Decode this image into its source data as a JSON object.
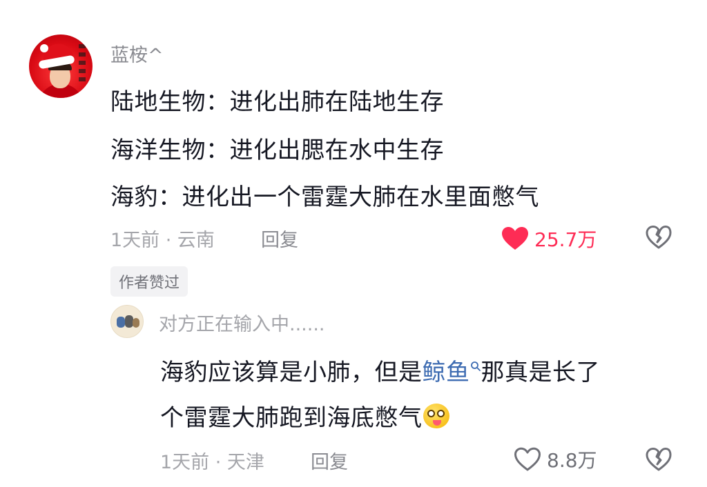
{
  "comment": {
    "username": "蓝桉^",
    "lines": [
      "陆地生物：进化出肺在陆地生存",
      "海洋生物：进化出腮在水中生存",
      "海豹：进化出一个雷霆大肺在水里面憋气"
    ],
    "meta": "1天前 · 云南",
    "reply_label": "回复",
    "like_count": "25.7万",
    "liked": true,
    "badge": "作者赞过"
  },
  "reply": {
    "username": "对方正在输入中......",
    "line1_prefix": "海豹应该算是小肺，但是",
    "keyword": "鲸鱼",
    "line1_suffix": "那真是长了",
    "line2": "个雷霆大肺跑到海底憋气",
    "meta": "1天前 · 天津",
    "reply_label": "回复",
    "like_count": "8.8万",
    "liked": false
  },
  "colors": {
    "accent_like": "#fe2c55",
    "keyword_link": "#3e6cb2",
    "secondary_text": "#a4a5aa"
  },
  "icons": {
    "like": "heart-icon",
    "dislike": "broken-heart-icon",
    "keyword_search": "search-icon",
    "emoji": "dizzy-tongue-emoji-icon"
  }
}
